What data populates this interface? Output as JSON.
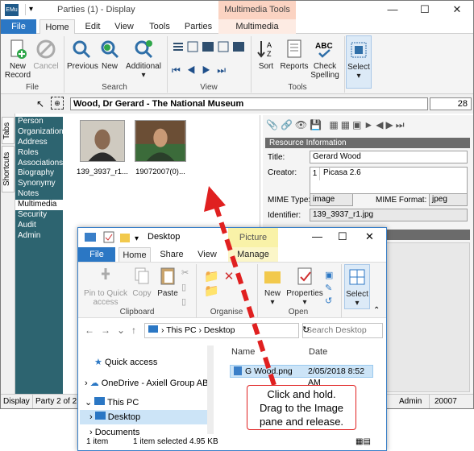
{
  "window": {
    "title": "Parties (1) - Display",
    "context_header": "Multimedia Tools",
    "app_icon": "EMu",
    "controls": [
      "—",
      "☐",
      "✕"
    ]
  },
  "tabs": [
    "File",
    "Home",
    "Edit",
    "View",
    "Tools",
    "Parties",
    "Multimedia"
  ],
  "ribbon": {
    "file_group": {
      "label": "File",
      "buttons": [
        "New Record",
        "Cancel"
      ]
    },
    "search_group": {
      "label": "Search",
      "buttons": [
        "Previous",
        "New",
        "Additional"
      ]
    },
    "view_group": {
      "label": "View"
    },
    "tools_group": {
      "label": "Tools",
      "buttons": [
        "Sort",
        "Reports",
        "Check Spelling"
      ]
    },
    "select_group": {
      "buttons": [
        "Select"
      ]
    }
  },
  "record": {
    "title": "Wood, Dr Gerard - The National Museum",
    "number": "28"
  },
  "side_tabs": [
    "Tabs",
    "Shortcuts"
  ],
  "nav_items": [
    "Person",
    "Organization",
    "Address",
    "Roles",
    "Associations",
    "Biography",
    "Synonymy",
    "Notes",
    "Multimedia",
    "Security",
    "Audit",
    "Admin"
  ],
  "nav_selected": "Multimedia",
  "thumbnails": [
    {
      "caption": "139_3937_r1..."
    },
    {
      "caption": "19072007(0)..."
    }
  ],
  "resource": {
    "section1": "Resource Information",
    "title_label": "Title:",
    "title_value": "Gerard Wood",
    "creator_label": "Creator:",
    "creator_index": "1",
    "creator_value": "Picasa 2.6",
    "mime_type_label": "MIME Type:",
    "mime_type_value": "image",
    "mime_format_label": "MIME Format:",
    "mime_format_value": "jpeg",
    "identifier_label": "Identifier:",
    "identifier_value": "139_3937_r1.jpg"
  },
  "status": {
    "mode": "Display",
    "party": "Party 2 of 2",
    "user": "Admin",
    "id": "20007"
  },
  "explorer": {
    "title": "Desktop",
    "context_header": "Picture Tools",
    "tabs": [
      "File",
      "Home",
      "Share",
      "View",
      "Manage"
    ],
    "clipboard": {
      "label": "Clipboard",
      "buttons": [
        "Pin to Quick access",
        "Copy",
        "Paste"
      ]
    },
    "organise": {
      "label": "Organise"
    },
    "open": {
      "label": "Open",
      "buttons": [
        "New",
        "Properties"
      ]
    },
    "select": {
      "buttons": [
        "Select"
      ]
    },
    "address": [
      "This PC",
      "Desktop"
    ],
    "search_placeholder": "Search Desktop",
    "tree": [
      "Quick access",
      "OneDrive - Axiell Group AB",
      "This PC",
      "Desktop",
      "Documents"
    ],
    "columns": [
      "Name",
      "Date"
    ],
    "files": [
      {
        "name": "G Wood.png",
        "date": "2/05/2018 8:52 AM"
      }
    ],
    "status": {
      "count": "1 item",
      "selected": "1 item selected  4.95 KB"
    }
  },
  "callout": {
    "lines": [
      "Click and hold.",
      "Drag to the Image",
      "pane and release."
    ]
  },
  "colors": {
    "accent": "#2b77c4",
    "nav": "#2d6470",
    "arrow": "#e02020"
  }
}
